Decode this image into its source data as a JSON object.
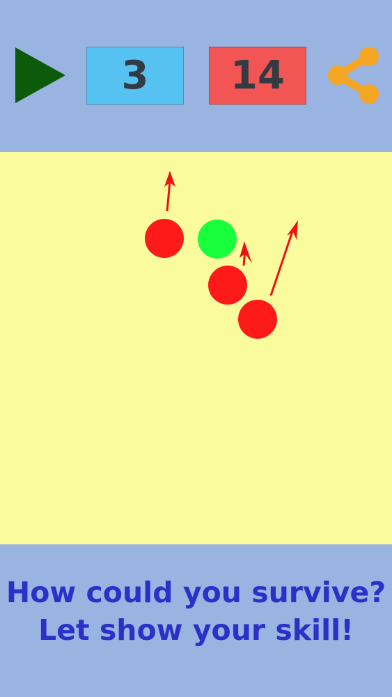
{
  "header": {
    "score": "3",
    "best_score": "14"
  },
  "icons": {
    "play": "play-icon",
    "share": "share-icon"
  },
  "colors": {
    "background": "#99b4e0",
    "field": "#f9fb9d",
    "play": "#0b5b0b",
    "score_box": "#56c2f2",
    "best_box": "#f25654",
    "share": "#f5a623",
    "enemy_ball": "#ff1a1a",
    "player_ball": "#1aff3c",
    "arrow": "#ee1111",
    "tagline": "#2b30c8"
  },
  "footer": {
    "line1": "How could you survive?",
    "line2": "Let show your skill!"
  }
}
